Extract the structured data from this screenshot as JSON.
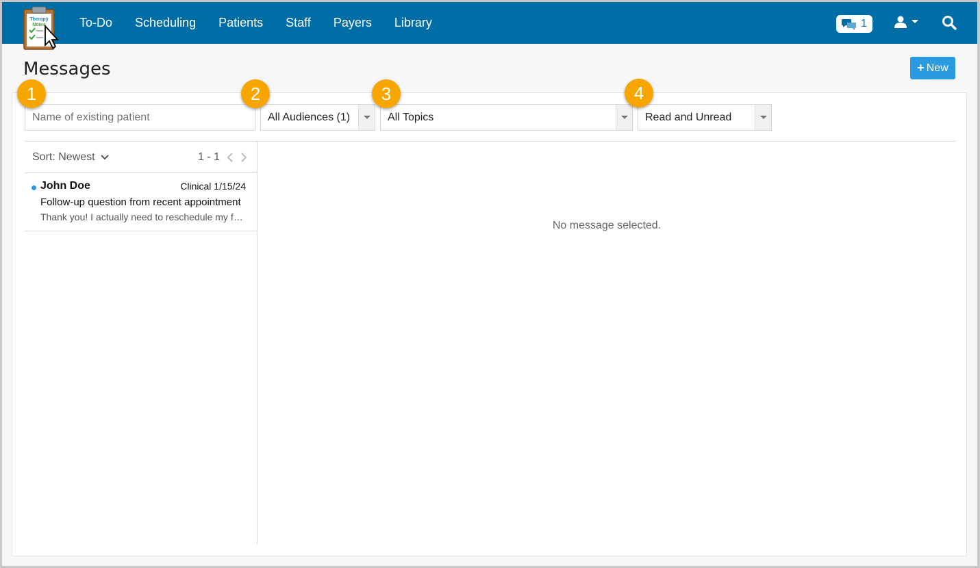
{
  "nav": {
    "logo_text_line1": "Therapy",
    "logo_text_line2": "Notes",
    "links": [
      "To-Do",
      "Scheduling",
      "Patients",
      "Staff",
      "Payers",
      "Library"
    ],
    "message_count": "1"
  },
  "page": {
    "title": "Messages",
    "new_label": "New"
  },
  "filters": {
    "patient_placeholder": "Name of existing patient",
    "audience": "All Audiences (1)",
    "topic": "All Topics",
    "read_state": "Read and Unread"
  },
  "list": {
    "sort_label": "Sort: Newest",
    "pager": "1 - 1",
    "items": [
      {
        "name": "John Doe",
        "meta": "Clinical 1/15/24",
        "subject": "Follow-up question from recent appointment",
        "preview": "Thank you! I actually need to reschedule my follow-up appointment"
      }
    ]
  },
  "detail": {
    "empty": "No message selected."
  },
  "callouts": [
    "1",
    "2",
    "3",
    "4"
  ],
  "colors": {
    "nav_bg": "#006ea6",
    "accent": "#2b9be0",
    "callout": "#f7a600"
  }
}
